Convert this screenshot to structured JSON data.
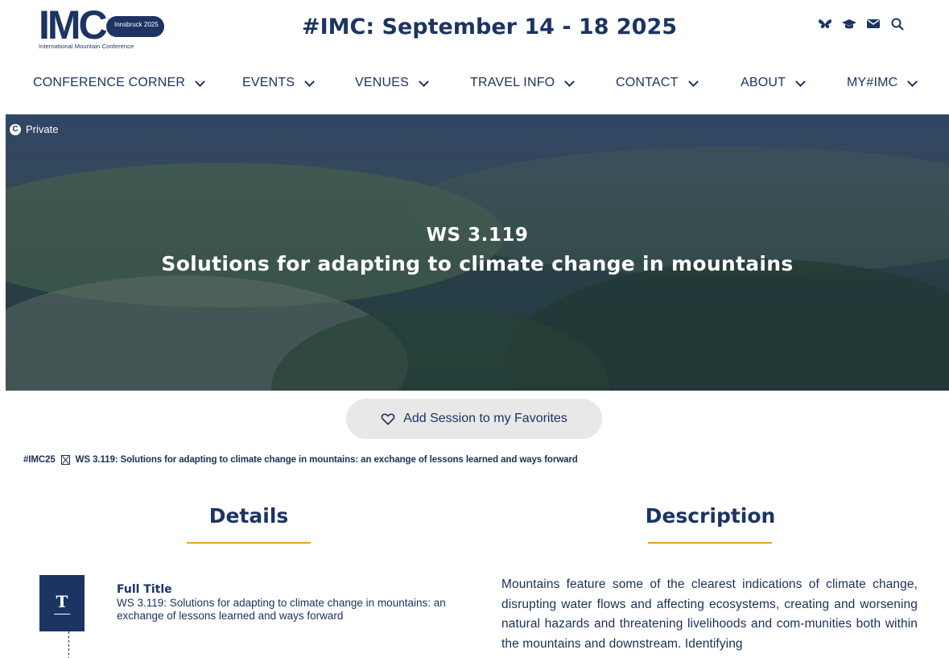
{
  "header": {
    "logo": {
      "main": "IMC",
      "pill": "Innsbruck 2025",
      "sub": "International Mountain Conference"
    },
    "headline": "#IMC: September 14 - 18 2025",
    "icons": [
      "butterfly-icon",
      "graduation-cap-icon",
      "mail-icon",
      "search-icon"
    ]
  },
  "nav": {
    "items": [
      {
        "label": "CONFERENCE CORNER"
      },
      {
        "label": "EVENTS"
      },
      {
        "label": "VENUES"
      },
      {
        "label": "TRAVEL INFO"
      },
      {
        "label": "CONTACT"
      },
      {
        "label": "ABOUT"
      },
      {
        "label": "MY#IMC"
      }
    ]
  },
  "hero": {
    "badge": "Private",
    "code": "WS 3.119",
    "title": "Solutions for adapting to climate change in mountains"
  },
  "favorites": {
    "label": "Add Session to my Favorites"
  },
  "breadcrumb": {
    "root": "#IMC25",
    "current": "WS 3.119: Solutions for adapting to climate change in mountains: an exchange of lessons learned and ways forward"
  },
  "details": {
    "heading": "Details",
    "full_title_label": "Full Title",
    "full_title_value": "WS 3.119: Solutions for adapting to climate change in mountains: an exchange of lessons learned and ways forward"
  },
  "description": {
    "heading": "Description",
    "text": "Mountains feature some of the clearest indications of climate change, disrupting water flows and affecting ecosystems, creating and worsening natural hazards and threatening livelihoods and com-munities both within the mountains and downstream. Identifying"
  },
  "colors": {
    "brand": "#1c3462",
    "accent": "#e0a330",
    "button_bg": "#e8e8e8"
  }
}
